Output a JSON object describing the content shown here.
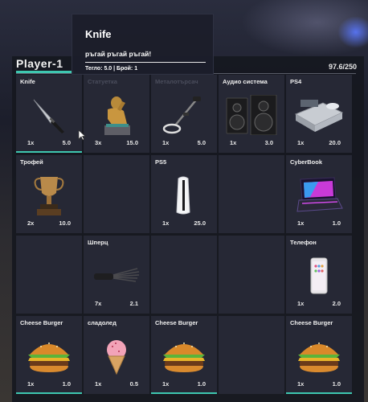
{
  "player": {
    "name": "Player-1",
    "weight": "97.6/250"
  },
  "tooltip": {
    "title": "Knife",
    "description": "ръгай ръгай ръгай!",
    "meta": "Тегло: 5.0 | Брой: 1"
  },
  "slots": [
    {
      "label": "Knife",
      "count": "1x",
      "weight": "5.0",
      "icon": "knife-icon"
    },
    {
      "label": "Статуетка",
      "count": "3x",
      "weight": "15.0",
      "icon": "thinker-statue-icon"
    },
    {
      "label": "Металотърсач",
      "count": "1x",
      "weight": "5.0",
      "icon": "metal-detector-icon"
    },
    {
      "label": "Аудио система",
      "count": "1x",
      "weight": "3.0",
      "icon": "speakers-icon"
    },
    {
      "label": "PS4",
      "count": "1x",
      "weight": "20.0",
      "icon": "ps4-console-icon"
    },
    {
      "label": "Трофей",
      "count": "2x",
      "weight": "10.0",
      "icon": "trophy-icon"
    },
    {
      "label": "",
      "count": "",
      "weight": ""
    },
    {
      "label": "PS5",
      "count": "1x",
      "weight": "25.0",
      "icon": "ps5-console-icon"
    },
    {
      "label": "",
      "count": "",
      "weight": ""
    },
    {
      "label": "CyberBook",
      "count": "1x",
      "weight": "1.0",
      "icon": "laptop-icon"
    },
    {
      "label": "",
      "count": "",
      "weight": ""
    },
    {
      "label": "Шперц",
      "count": "7x",
      "weight": "2.1",
      "icon": "lockpick-icon"
    },
    {
      "label": "",
      "count": "",
      "weight": ""
    },
    {
      "label": "",
      "count": "",
      "weight": ""
    },
    {
      "label": "Телефон",
      "count": "1x",
      "weight": "2.0",
      "icon": "phone-icon"
    },
    {
      "label": "Cheese Burger",
      "count": "1x",
      "weight": "1.0",
      "icon": "burger-icon"
    },
    {
      "label": "сладолед",
      "count": "1x",
      "weight": "0.5",
      "icon": "ice-cream-icon"
    },
    {
      "label": "Cheese Burger",
      "count": "1x",
      "weight": "1.0",
      "icon": "burger-icon"
    },
    {
      "label": "",
      "count": "",
      "weight": ""
    },
    {
      "label": "Cheese Burger",
      "count": "1x",
      "weight": "1.0",
      "icon": "burger-icon"
    }
  ]
}
